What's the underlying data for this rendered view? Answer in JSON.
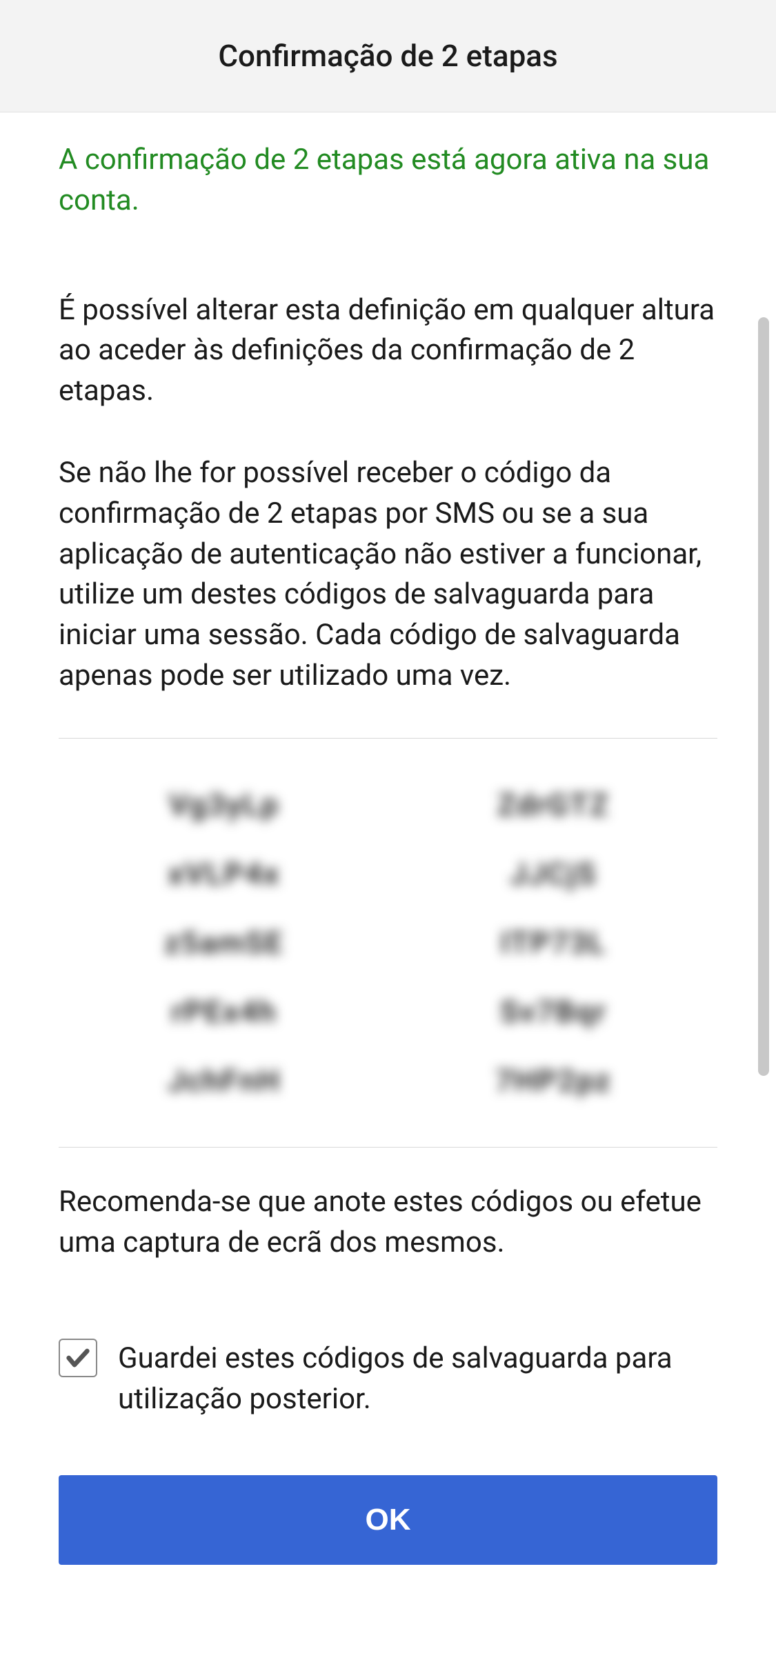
{
  "header": {
    "title": "Confirmação de 2 etapas"
  },
  "status": {
    "message": "A confirmação de 2 etapas está agora ativa na sua conta."
  },
  "body": {
    "paragraph1": "É possível alterar esta definição em qualquer altura ao aceder às definições da confirmação de 2 etapas.",
    "paragraph2": "Se não lhe for possível receber o código da confirmação de 2 etapas por SMS ou se a sua aplicação de autenticação não estiver a funcionar, utilize um destes códigos de salvaguarda para iniciar uma sessão. Cada código de salvaguarda apenas pode ser utilizado uma vez."
  },
  "codes": {
    "column1": [
      "Vg3yLp",
      "xVLP4x",
      "z5amSE",
      "rPEx4h",
      "JchFnH"
    ],
    "column2": [
      "ZdrGTZ",
      "JJCjS",
      "ITP73L",
      "Sv7Bqr",
      "7HP2pz"
    ]
  },
  "recommendation": "Recomenda-se que anote estes códigos ou efetue uma captura de ecrã dos mesmos.",
  "checkbox": {
    "label": "Guardei estes códigos de salvaguarda para utilização posterior.",
    "checked": true
  },
  "buttons": {
    "ok": "OK"
  }
}
